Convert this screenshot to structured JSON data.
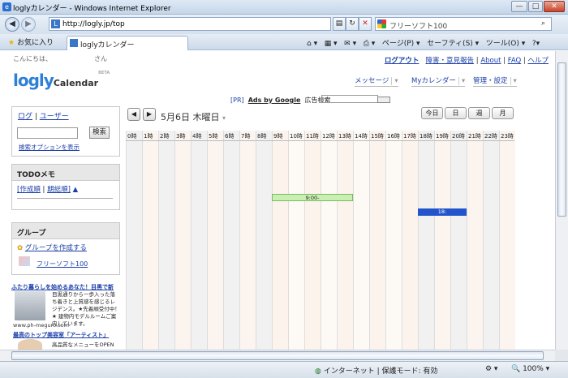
{
  "window": {
    "title": "loglyカレンダー - Windows Internet Explorer",
    "min": "—",
    "max": "□",
    "close": "✕"
  },
  "address": {
    "url": "http://logly.jp/top",
    "search_placeholder": "フリーソフト100",
    "back": "◀",
    "fwd": "▶"
  },
  "tabs": {
    "favorites": "お気に入り",
    "active_tab": "loglyカレンダー"
  },
  "toolbar": {
    "page": "ページ(P)",
    "safety": "セーフティ(S)",
    "tools": "ツール(O)"
  },
  "header": {
    "greeting": "こんにちは、　　　　　　　さん",
    "logout": "ログアウト",
    "feedback": "障害・意見報告",
    "about": "About",
    "faq": "FAQ",
    "help": "ヘルプ",
    "logo_main": "logly",
    "logo_sub": "Calendar",
    "logo_beta": "BETA"
  },
  "menu": {
    "message": "メッセージ",
    "mycal": "Myカレンダー",
    "manage": "管理・設定"
  },
  "ads": {
    "pr": "[PR]",
    "google": "Ads by Google",
    "search_label": "広告検索"
  },
  "sidebar": {
    "login": "ログ",
    "user": "ユーザー",
    "search_btn": "検索",
    "search_opts": "検索オプションを表示",
    "todo_title": "TODOメモ",
    "todo_created": "[作成順",
    "todo_deadline": "期総順]",
    "todo_arrow": "▲",
    "group_title": "グループ",
    "create_group": "グループを作成する",
    "group1": "フリーソフト100",
    "ad1_title": "ふたり暮らしを始めるあなた！目黒で新",
    "ad1_text": "目黒通りから一歩入った落ち着きと上質感を感じるレジデンス。★先着順受付中！★ 建物内モデルルームご案内しています。",
    "ad1_url": "www.ph-meguro.com",
    "ad2_title": "最高のトップ美容室「アーティスト」",
    "ad2_text": "高品質なメニューをOPEN"
  },
  "calendar": {
    "date": "5月6日  木曜日",
    "today": "今日",
    "day": "日",
    "week": "週",
    "month": "月",
    "hours": [
      "0時",
      "1時",
      "2時",
      "3時",
      "4時",
      "5時",
      "6時",
      "7時",
      "8時",
      "9時",
      "10時",
      "11時",
      "12時",
      "13時",
      "14時",
      "15時",
      "16時",
      "17時",
      "18時",
      "19時",
      "20時",
      "21時",
      "22時",
      "23時"
    ],
    "event1": "9:00-",
    "event2": "18:"
  },
  "status": {
    "zone": "インターネット | 保護モード: 有効",
    "zoom": "100%"
  },
  "colors": {
    "accent": "#2e7fd6",
    "link": "#1b3fa8",
    "event_green": "#c8f0b0",
    "event_blue": "#2255cc"
  }
}
